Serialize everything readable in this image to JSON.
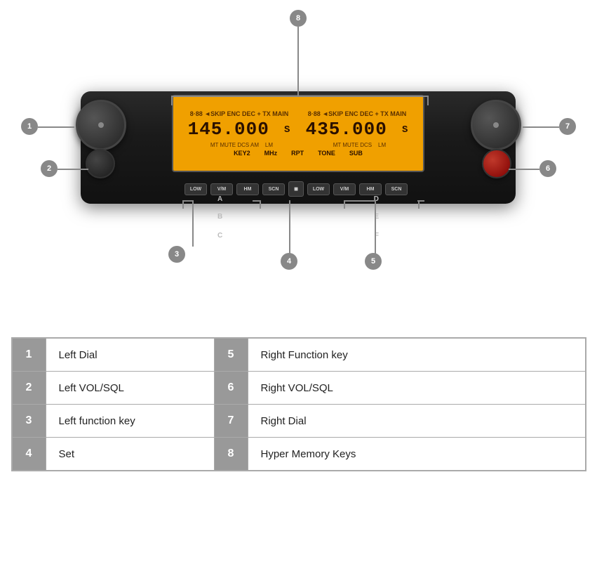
{
  "radio": {
    "dial_left_label": "1",
    "dial_left_small_label": "2",
    "label_a": "A",
    "label_b": "B",
    "label_c": "C",
    "label_d": "D",
    "label_e": "E",
    "label_f": "F",
    "display": {
      "freq_left": "145.000",
      "freq_right": "435.000",
      "top_left": "8·88 ◄SKIP  +  TX MAIN",
      "top_right": "8·88 ◄SKIP  +  TX MAIN",
      "bottom_left": "MT  MUTE  DCS  AM       LM",
      "bottom_right": "MT  MUTE  DCS       LM",
      "middle": "KEY2 MHz   RPT   TONE   SUB"
    },
    "buttons": [
      "LOW",
      "V/M",
      "HM",
      "SCN",
      "■",
      "LOW",
      "V/M",
      "HM",
      "SCN"
    ],
    "callouts": {
      "c1": "1",
      "c2": "2",
      "c3": "3",
      "c4": "4",
      "c5": "5",
      "c6": "6",
      "c7": "7",
      "c8": "8"
    }
  },
  "table": {
    "rows": [
      {
        "num_left": "1",
        "label_left": "Left Dial",
        "num_right": "5",
        "label_right": "Right Function key"
      },
      {
        "num_left": "2",
        "label_left": "Left VOL/SQL",
        "num_right": "6",
        "label_right": "Right VOL/SQL"
      },
      {
        "num_left": "3",
        "label_left": "Left function key",
        "num_right": "7",
        "label_right": "Right Dial"
      },
      {
        "num_left": "4",
        "label_left": "Set",
        "num_right": "8",
        "label_right": "Hyper Memory Keys"
      }
    ]
  }
}
